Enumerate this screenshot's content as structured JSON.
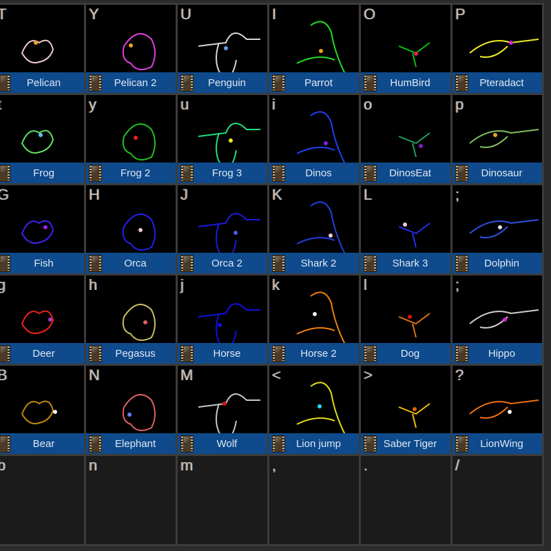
{
  "grid": {
    "rows": [
      [
        {
          "key": "T",
          "name": "Pelican",
          "color": "#f0c8d0",
          "accent": "#f0a020"
        },
        {
          "key": "Y",
          "name": "Pelican 2",
          "color": "#e040e0",
          "accent": "#f0a020"
        },
        {
          "key": "U",
          "name": "Penguin",
          "color": "#d8d8d8",
          "accent": "#6a9ae8"
        },
        {
          "key": "I",
          "name": "Parrot",
          "color": "#20e020",
          "accent": "#f0a020"
        },
        {
          "key": "O",
          "name": "HumBird",
          "color": "#10c010",
          "accent": "#e02060"
        },
        {
          "key": "P",
          "name": "Pteradact",
          "color": "#f0f020",
          "accent": "#e020e0"
        }
      ],
      [
        {
          "key": "t",
          "name": "Frog",
          "color": "#60e060",
          "accent": "#60c0f0"
        },
        {
          "key": "y",
          "name": "Frog 2",
          "color": "#20c020",
          "accent": "#f02020"
        },
        {
          "key": "u",
          "name": "Frog 3",
          "color": "#20e080",
          "accent": "#f0f020"
        },
        {
          "key": "i",
          "name": "Dinos",
          "color": "#2040f0",
          "accent": "#8020e0"
        },
        {
          "key": "o",
          "name": "DinosEat",
          "color": "#20a060",
          "accent": "#8020c0"
        },
        {
          "key": "p",
          "name": "Dinosaur",
          "color": "#80c060",
          "accent": "#f0a020"
        }
      ],
      [
        {
          "key": "G",
          "name": "Fish",
          "color": "#4020f0",
          "accent": "#a020f0"
        },
        {
          "key": "H",
          "name": "Orca",
          "color": "#2020f0",
          "accent": "#f0c0d0"
        },
        {
          "key": "J",
          "name": "Orca 2",
          "color": "#1a1ae0",
          "accent": "#4060f0"
        },
        {
          "key": "K",
          "name": "Shark 2",
          "color": "#2040e0",
          "accent": "#f0c8e0"
        },
        {
          "key": "L",
          "name": "Shark 3",
          "color": "#2030f0",
          "accent": "#f0c8e0"
        },
        {
          "key": ";",
          "name": "Dolphin",
          "color": "#3050e0",
          "accent": "#e0e0e0"
        }
      ],
      [
        {
          "key": "g",
          "name": "Deer",
          "color": "#f02020",
          "accent": "#a040c0"
        },
        {
          "key": "h",
          "name": "Pegasus",
          "color": "#c8c060",
          "accent": "#e06060"
        },
        {
          "key": "j",
          "name": "Horse",
          "color": "#1010e0",
          "accent": "#1010e0"
        },
        {
          "key": "k",
          "name": "Horse 2",
          "color": "#f08010",
          "accent": "#f0f0f0"
        },
        {
          "key": "l",
          "name": "Dog",
          "color": "#e07010",
          "accent": "#e01010"
        },
        {
          "key": ";",
          "name": "Hippo",
          "color": "#d0d0d0",
          "accent": "#e020e0"
        }
      ],
      [
        {
          "key": "B",
          "name": "Bear",
          "color": "#c08a10",
          "accent": "#f0f0f0"
        },
        {
          "key": "N",
          "name": "Elephant",
          "color": "#e06060",
          "accent": "#6080f0"
        },
        {
          "key": "M",
          "name": "Wolf",
          "color": "#c8c8c8",
          "accent": "#e01010"
        },
        {
          "key": "<",
          "name": "Lion jump",
          "color": "#e0e010",
          "accent": "#20e0f0"
        },
        {
          "key": ">",
          "name": "Saber Tiger",
          "color": "#f0c010",
          "accent": "#e06010"
        },
        {
          "key": "?",
          "name": "LionWing",
          "color": "#f07010",
          "accent": "#f0f0f0"
        }
      ],
      [
        {
          "key": "b",
          "name": ""
        },
        {
          "key": "n",
          "name": ""
        },
        {
          "key": "m",
          "name": ""
        },
        {
          "key": ",",
          "name": ""
        },
        {
          "key": ".",
          "name": ""
        },
        {
          "key": "/",
          "name": ""
        }
      ]
    ]
  },
  "icons": {
    "clip": "film-clip-icon"
  }
}
